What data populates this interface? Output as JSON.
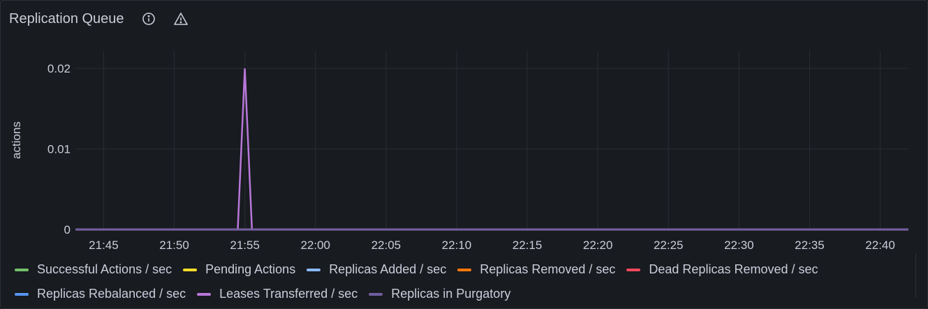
{
  "panel": {
    "title": "Replication Queue",
    "icons": [
      "info-icon",
      "warning-icon"
    ]
  },
  "chart_data": {
    "type": "line",
    "ylabel": "actions",
    "ylim": [
      0,
      0.02
    ],
    "yticks": [
      0,
      0.01,
      0.02
    ],
    "ytick_labels": [
      "0",
      "0.01",
      "0.02"
    ],
    "xticks": [
      "21:45",
      "21:50",
      "21:55",
      "22:00",
      "22:05",
      "22:10",
      "22:15",
      "22:20",
      "22:25",
      "22:30",
      "22:35",
      "22:40"
    ],
    "xlim": [
      "21:43",
      "22:42"
    ],
    "grid": true,
    "legend_position": "bottom",
    "series": [
      {
        "name": "Successful Actions / sec",
        "color": "#73bf69",
        "x": [
          "21:43",
          "22:42"
        ],
        "values": [
          0,
          0
        ]
      },
      {
        "name": "Pending Actions",
        "color": "#fade2a",
        "x": [
          "21:43",
          "22:42"
        ],
        "values": [
          0,
          0
        ]
      },
      {
        "name": "Replicas Added / sec",
        "color": "#8ab8ff",
        "x": [
          "21:43",
          "22:42"
        ],
        "values": [
          0,
          0
        ]
      },
      {
        "name": "Replicas Removed / sec",
        "color": "#ff780a",
        "x": [
          "21:43",
          "22:42"
        ],
        "values": [
          0,
          0
        ]
      },
      {
        "name": "Dead Replicas Removed / sec",
        "color": "#f2495c",
        "x": [
          "21:43",
          "22:42"
        ],
        "values": [
          0,
          0
        ]
      },
      {
        "name": "Replicas Rebalanced / sec",
        "color": "#5794f2",
        "x": [
          "21:43",
          "22:42"
        ],
        "values": [
          0,
          0
        ]
      },
      {
        "name": "Leases Transferred / sec",
        "color": "#b877d9",
        "x": [
          "21:43",
          "21:54.5",
          "21:55",
          "21:55.5",
          "22:42"
        ],
        "values": [
          0,
          0,
          0.02,
          0,
          0
        ]
      },
      {
        "name": "Replicas in Purgatory",
        "color": "#705da0",
        "x": [
          "21:43",
          "22:42"
        ],
        "values": [
          0,
          0
        ]
      }
    ]
  }
}
